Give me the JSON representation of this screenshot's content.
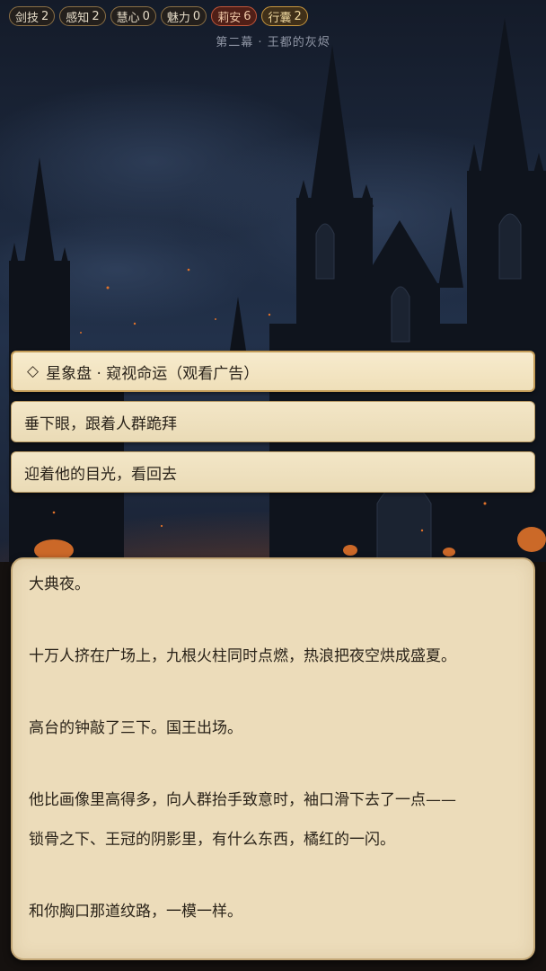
{
  "stats": [
    {
      "label": "剑技",
      "value": "2",
      "kind": "normal"
    },
    {
      "label": "感知",
      "value": "2",
      "kind": "normal"
    },
    {
      "label": "慧心",
      "value": "0",
      "kind": "normal"
    },
    {
      "label": "魅力",
      "value": "0",
      "kind": "normal"
    },
    {
      "label": "莉安",
      "value": "6",
      "kind": "companion"
    },
    {
      "label": "行囊",
      "value": "2",
      "kind": "bag"
    }
  ],
  "chapter_title": "第二幕 · 王都的灰烬",
  "choices": [
    {
      "icon": "diamond-outline-icon",
      "label": "星象盘 · 窥视命运（观看广告）"
    },
    {
      "label": "垂下眼，跟着人群跪拜"
    },
    {
      "label": "迎着他的目光，看回去"
    }
  ],
  "story": {
    "paragraphs": [
      [
        "大典夜。"
      ],
      [
        "十万人挤在广场上，九根火柱同时点燃，热浪把夜空烘成盛夏。"
      ],
      [
        "高台的钟敲了三下。国王出场。"
      ],
      [
        "他比画像里高得多，向人群抬手致意时，袖口滑下去了一点——",
        "锁骨之下、王冠的阴影里，有什么东西，橘红的一闪。"
      ],
      [
        "和你胸口那道纹路，一模一样。"
      ]
    ]
  },
  "colors": {
    "parchment": "#ecdcba",
    "companion_accent": "#c0563a",
    "bag_accent": "#c7963e",
    "fire": "#e0722a"
  }
}
